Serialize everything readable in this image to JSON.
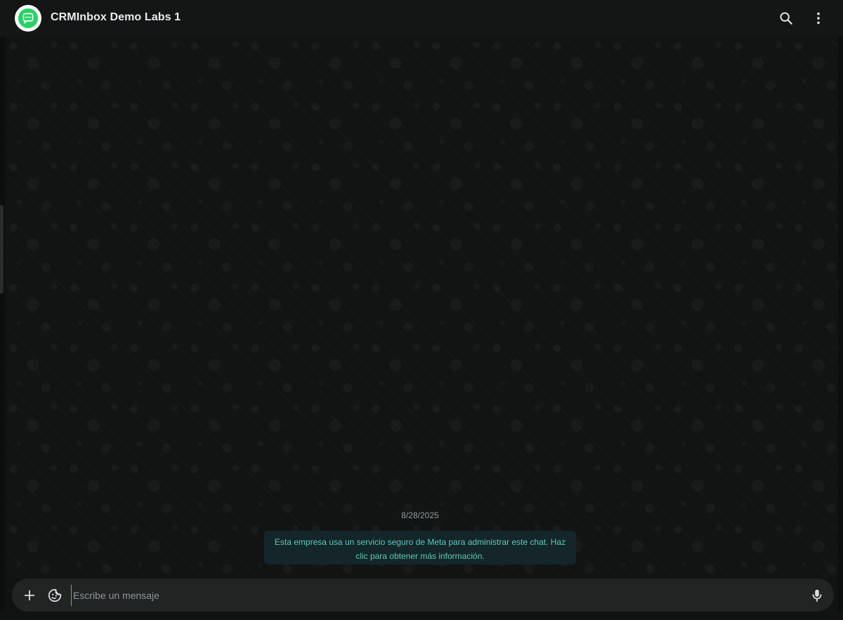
{
  "header": {
    "title": "CRMInbox Demo Labs 1",
    "avatar_icon": "chat-bubble-icon",
    "search_icon": "search-icon",
    "menu_icon": "more-vertical-icon"
  },
  "chat": {
    "date": "8/28/2025",
    "system_message": "Esta empresa usa un servicio seguro de Meta para administrar este chat. Haz clic para obtener más información."
  },
  "composer": {
    "placeholder": "Escribe un mensaje",
    "value": "",
    "attach_icon": "plus-icon",
    "sticker_icon": "sticker-icon",
    "mic_icon": "microphone-icon"
  },
  "colors": {
    "accent": "#25d366",
    "system_text": "#5cc9b8",
    "header_bg": "#141616",
    "composer_bg": "#222424"
  }
}
